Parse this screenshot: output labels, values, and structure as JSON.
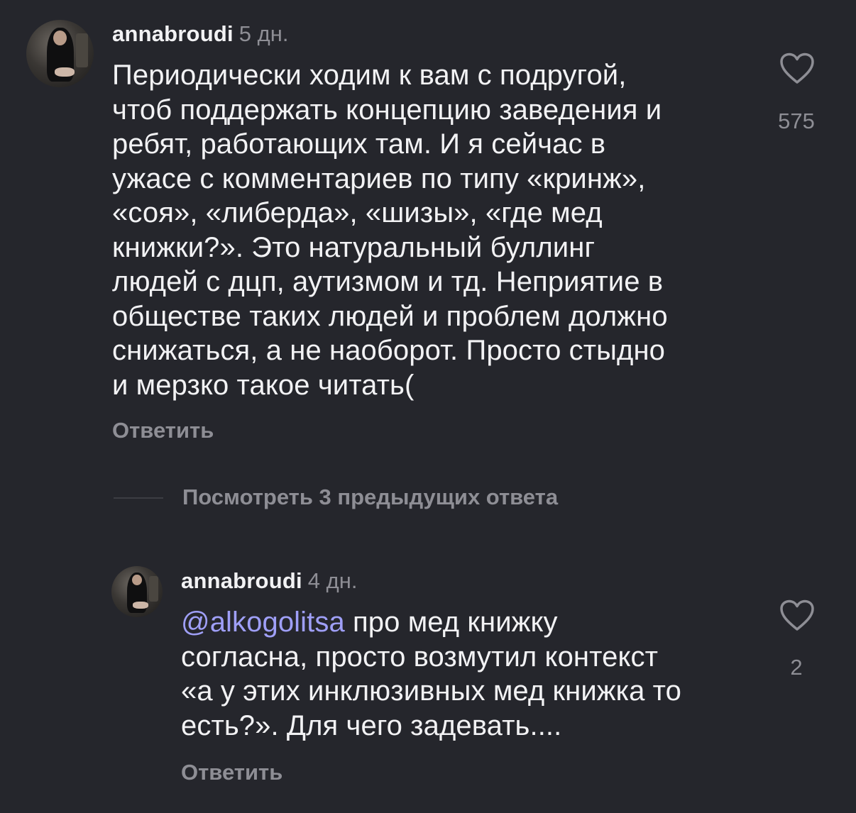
{
  "comments": [
    {
      "username": "annabroudi",
      "time": "5 дн.",
      "lines": [
        "Периодически ходим к вам с подругой,",
        "чтоб поддержать концепцию заведения и",
        "ребят, работающих там. И я сейчас в",
        "ужасе с комментариев по типу «кринж»,",
        "«соя», «либерда», «шизы», «где мед",
        "книжки?». Это натуральный буллинг",
        "людей с дцп, аутизмом и тд. Неприятие в",
        "обществе таких людей и проблем должно",
        "снижаться, а не наоборот. Просто стыдно",
        "и мерзко такое читать("
      ],
      "reply_label": "Ответить",
      "likes": "575"
    }
  ],
  "view_previous_replies": "Посмотреть 3 предыдущих ответа",
  "reply": {
    "username": "annabroudi",
    "time": "4 дн.",
    "mention": "@alkogolitsa",
    "line1_rest": " про мед книжку",
    "lines": [
      "согласна, просто возмутил контекст",
      "«а у этих инклюзивных мед книжка то",
      "есть?». Для чего задевать...."
    ],
    "reply_label": "Ответить",
    "likes": "2"
  },
  "colors": {
    "background": "#25262c",
    "text": "#f2f2f4",
    "secondary": "#8e8e95",
    "mention": "#9f9ff7"
  },
  "icons": {
    "like": "heart-outline-icon"
  }
}
